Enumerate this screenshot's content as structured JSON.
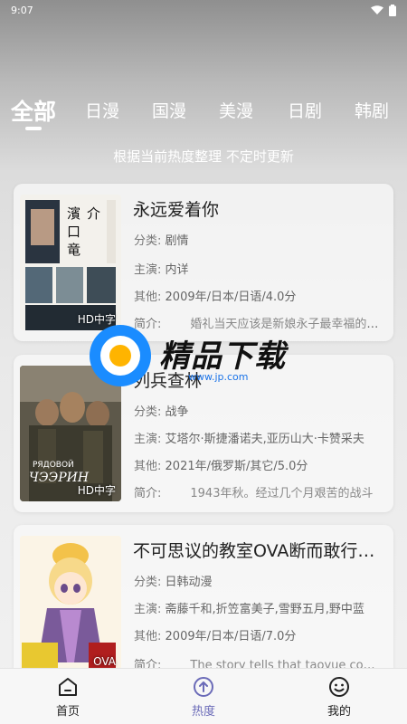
{
  "status": {
    "time": "9:07"
  },
  "tabs": [
    {
      "label": "全部",
      "active": true
    },
    {
      "label": "日漫"
    },
    {
      "label": "国漫"
    },
    {
      "label": "美漫"
    },
    {
      "label": "日剧"
    },
    {
      "label": "韩剧"
    }
  ],
  "subtitle": "根据当前热度整理 不定时更新",
  "labels": {
    "category": "分类:",
    "cast": "主演:",
    "other": "其他:",
    "intro": "简介:"
  },
  "items": [
    {
      "title": "永远爱着你",
      "category": "剧情",
      "cast": "内详",
      "other": "2009年/日本/日语/4.0分",
      "intro": "婚礼当天应该是新娘永子最幸福的一天",
      "badge": "HD中字",
      "poster_text": "濱口竜介",
      "poster_colors": [
        "#f4f2ee",
        "#1d2a36",
        "#6b7f8c"
      ]
    },
    {
      "title": "列兵查林",
      "category": "战争",
      "cast": "艾塔尔·斯捷潘诺夫,亚历山大·卡赞采夫",
      "other": "2021年/俄罗斯/其它/5.0分",
      "intro": "1943年秋。经过几个月艰苦的战斗",
      "badge": "HD中字",
      "poster_text": "РЯДОВОЙ ЧЭЭРИН",
      "poster_colors": [
        "#4a4a3a",
        "#8a6f4a",
        "#2e2a22"
      ]
    },
    {
      "title": "不可思议的教室OVA断而敢行之章",
      "category": "日韩动漫",
      "cast": "斋藤千和,折笠富美子,雪野五月,野中蓝",
      "other": "2009年/日本/日语/7.0分",
      "intro": "The story tells that taoyue comes to school",
      "badge": "OVA",
      "poster_text": "",
      "poster_colors": [
        "#fff6d8",
        "#f3c24a",
        "#6a4a8a"
      ]
    }
  ],
  "watermark": {
    "text": "精品下载",
    "url": "www.jp.com"
  },
  "nav": [
    {
      "label": "首页",
      "icon": "home-icon",
      "active": false
    },
    {
      "label": "热度",
      "icon": "trending-icon",
      "active": true
    },
    {
      "label": "我的",
      "icon": "profile-smile-icon",
      "active": false
    }
  ],
  "colors": {
    "accent": "#6b6bb8",
    "text": "#222222",
    "muted": "#666666"
  }
}
